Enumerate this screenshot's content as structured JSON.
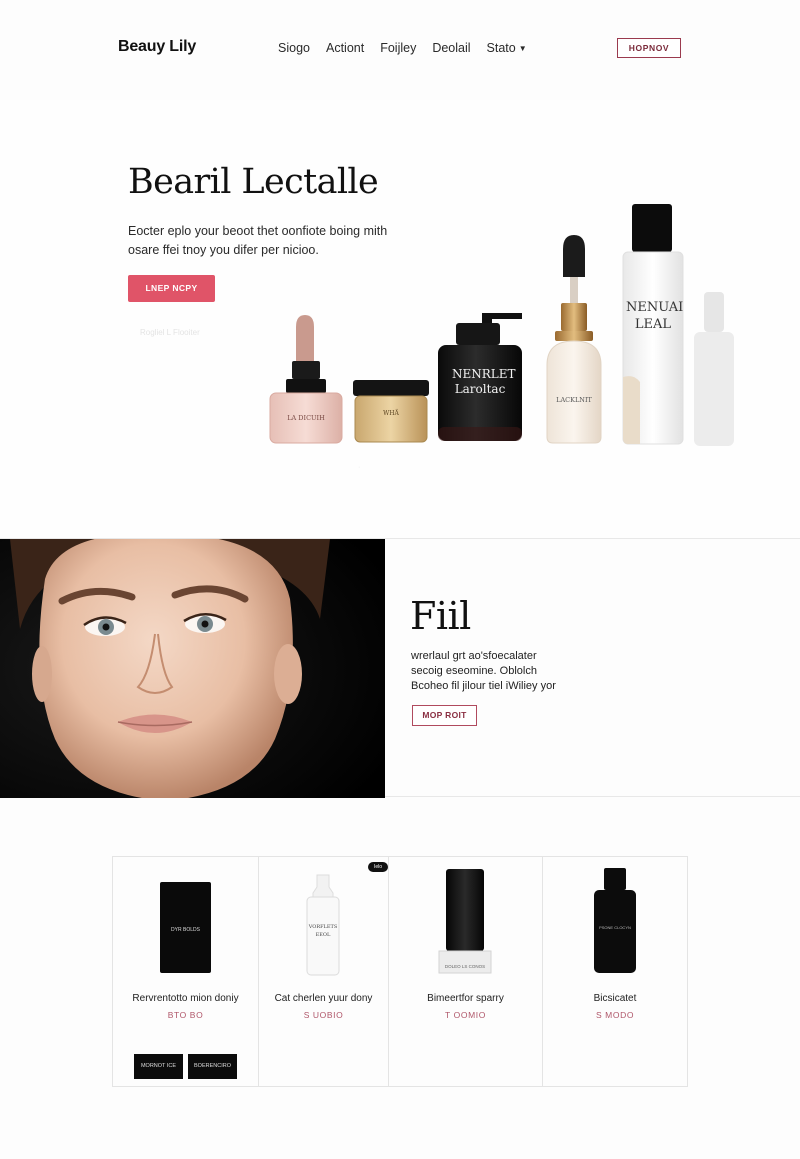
{
  "header": {
    "brand": "Beauy Lily",
    "nav": [
      {
        "label": "Siogo"
      },
      {
        "label": "Actiont"
      },
      {
        "label": "Foijley"
      },
      {
        "label": "Deolail"
      },
      {
        "label": "Stato"
      }
    ],
    "cta": "HOPNOV"
  },
  "hero": {
    "title": "Bearil Lectalle",
    "text": "Eocter eplo your beoot thet oonfiote boing mith osare ffei tnoy you difer per nicioo.",
    "button": "LNEP NCPY",
    "faint_caption": "Rogliel L Flooiter",
    "products": [
      {
        "label": "LA DICUIH"
      },
      {
        "label": "WHÄ"
      },
      {
        "label": "NENRLET Laroltac"
      },
      {
        "label": "LACKLNIT"
      },
      {
        "label": "NENUAI LEAL"
      }
    ]
  },
  "feature": {
    "title": "Fiil",
    "text_lines": [
      "wrerlaul grt ao'sfoecalater",
      "secoig eseomine. Oblolch",
      "Bcoheo  fil jilour  tiel iWiliey yor"
    ],
    "button": "MOP ROIT"
  },
  "products": {
    "cards": [
      {
        "name": "Rervrentotto mion doniy",
        "price": "BTO BO",
        "product_label": "DYR BOLDS"
      },
      {
        "name": "Cat cherlen yuur dony",
        "price": "S UOBIO",
        "product_label": "VORFLETS EEOL",
        "badge": "Ielo"
      },
      {
        "name": "Bimeertfor sparry",
        "price": "T OOMIO",
        "product_label": "DOLEO LS CONOS"
      },
      {
        "name": "Bicsicatet",
        "price": "S MODO",
        "product_label": "PSONE CLOCYN"
      }
    ],
    "mini_buttons": [
      "MORNOT ICE",
      "BOERENCIRO"
    ]
  }
}
